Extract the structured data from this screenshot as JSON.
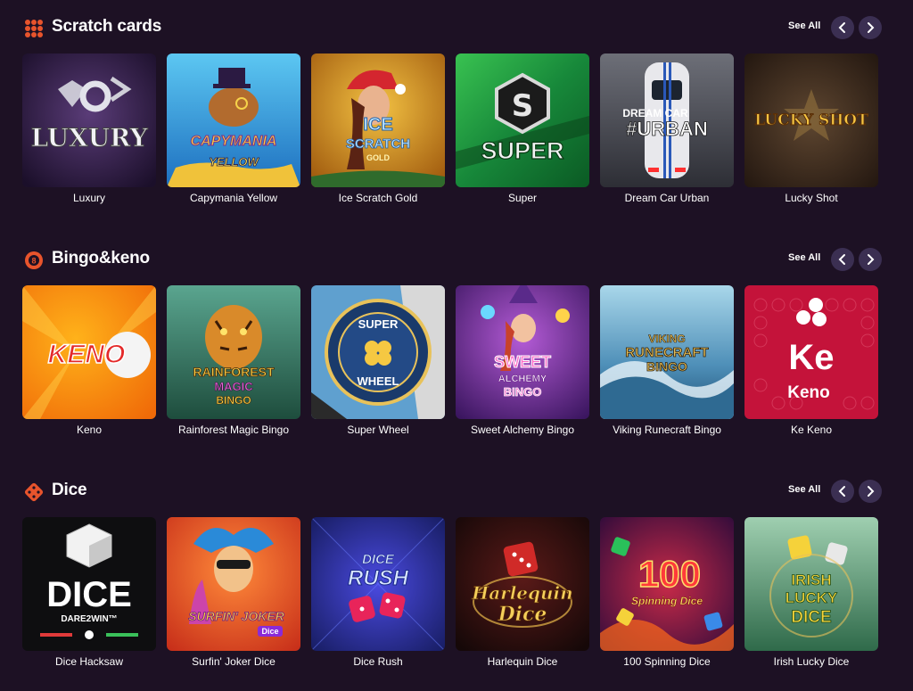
{
  "ui": {
    "see_all": "See All"
  },
  "sections": [
    {
      "title": "Scratch cards",
      "icon": "scratch-cards-icon",
      "games": [
        {
          "name": "Luxury",
          "art": "LUXURY"
        },
        {
          "name": "Capymania Yellow",
          "art": "CAPYMANIA",
          "art2": "YELLOW"
        },
        {
          "name": "Ice Scratch Gold",
          "art": "ICE",
          "art2": "SCRATCH",
          "art3": "GOLD"
        },
        {
          "name": "Super",
          "art": "SUPER"
        },
        {
          "name": "Dream Car Urban",
          "art": "DREAM CAR",
          "art2": "#URBAN"
        },
        {
          "name": "Lucky Shot",
          "art": "LUCKY SHOT"
        }
      ]
    },
    {
      "title": "Bingo&keno",
      "icon": "bingo-ball-icon",
      "games": [
        {
          "name": "Keno",
          "art": "KENO"
        },
        {
          "name": "Rainforest Magic Bingo",
          "art": "RAINFOREST",
          "art2": "MAGIC",
          "art3": "BINGO"
        },
        {
          "name": "Super Wheel",
          "art": "SUPER",
          "art2": "WHEEL"
        },
        {
          "name": "Sweet Alchemy Bingo",
          "art": "SWEET",
          "art2": "ALCHEMY",
          "art3": "BINGO"
        },
        {
          "name": "Viking Runecraft Bingo",
          "art": "VIKING",
          "art2": "RUNECRAFT",
          "art3": "BINGO"
        },
        {
          "name": "Ke Keno",
          "art": "Ke",
          "art2": "Keno"
        }
      ]
    },
    {
      "title": "Dice",
      "icon": "dice-icon",
      "games": [
        {
          "name": "Dice Hacksaw",
          "art": "DICE",
          "art2": "DARE2WIN™"
        },
        {
          "name": "Surfin' Joker Dice",
          "art": "SURFIN' JOKER",
          "art2": "Dice"
        },
        {
          "name": "Dice Rush",
          "art": "DICE",
          "art2": "RUSH"
        },
        {
          "name": "Harlequin Dice",
          "art": "Harlequin",
          "art2": "Dice"
        },
        {
          "name": "100 Spinning Dice",
          "art": "100",
          "art2": "Spinning Dice"
        },
        {
          "name": "Irish Lucky Dice",
          "art": "IRISH",
          "art2": "LUCKY",
          "art3": "DICE"
        }
      ]
    }
  ],
  "colors": {
    "background": "#1d1124",
    "nav_button": "#3b2f52",
    "accent": "#e8542c"
  }
}
